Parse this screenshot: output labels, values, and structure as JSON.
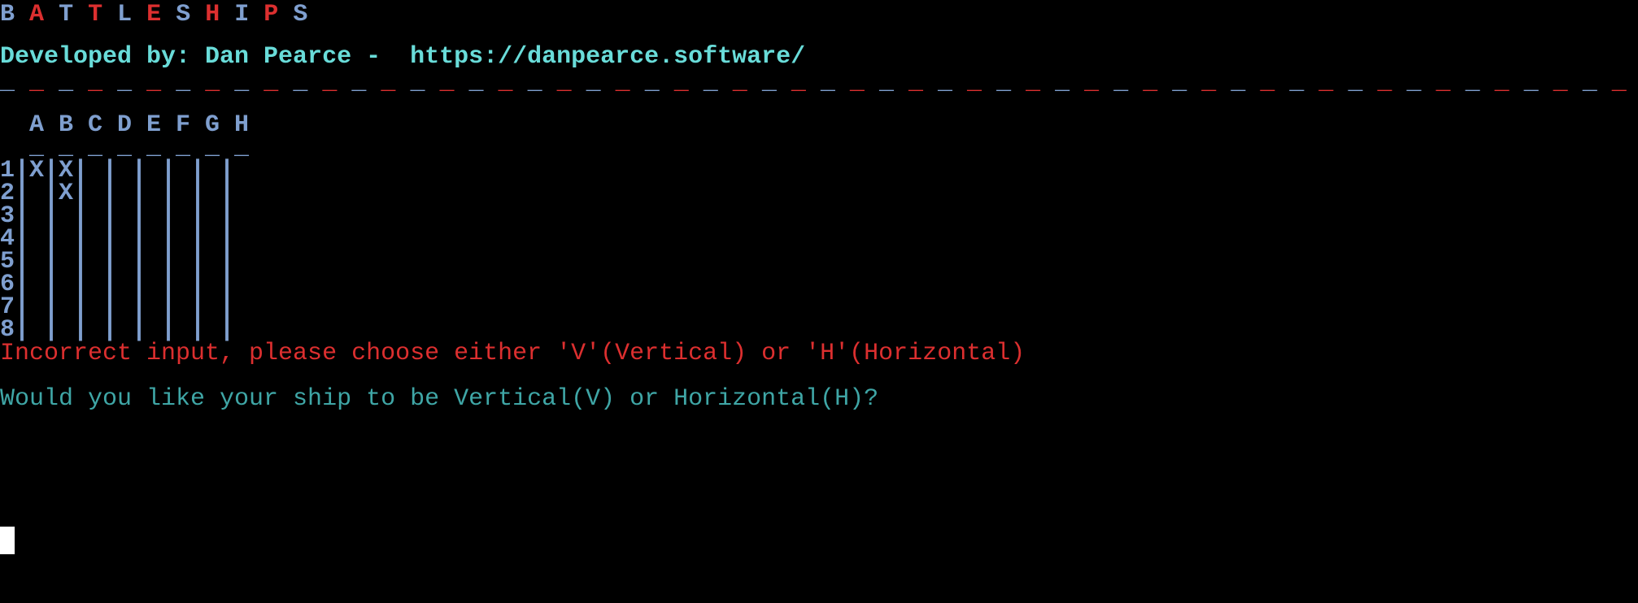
{
  "title": {
    "letters": [
      "B",
      "A",
      "T",
      "T",
      "L",
      "E",
      "S",
      "H",
      "I",
      "P",
      "S"
    ],
    "colors": [
      "blue",
      "red",
      "blue",
      "red",
      "blue",
      "red",
      "blue",
      "red",
      "blue",
      "red",
      "blue"
    ]
  },
  "developer_line": "Developed by: Dan Pearce -  https://danpearce.software/",
  "separator": {
    "count": 56,
    "pattern": [
      "blue",
      "red"
    ]
  },
  "board": {
    "columns_header": "  A B C D E F G H",
    "top_border": "  _ _ _ _ _ _ _ _",
    "rows": [
      "1|X|X| | | | | |",
      "2| |X| | | | | |",
      "3| | | | | | | |",
      "4| | | | | | | |",
      "5| | | | | | | |",
      "6| | | | | | | |",
      "7| | | | | | | |",
      "8| | | | | | | |"
    ]
  },
  "error_message": "Incorrect input, please choose either 'V'(Vertical) or 'H'(Horizontal)",
  "prompt": "Would you like your ship to be Vertical(V) or Horizontal(H)?",
  "colors": {
    "background": "#000000",
    "blue": "#7f9fcf",
    "red": "#dc2f2f",
    "cyan": "#69dcd9",
    "teal": "#3fa6a6",
    "cursor": "#ffffff"
  }
}
